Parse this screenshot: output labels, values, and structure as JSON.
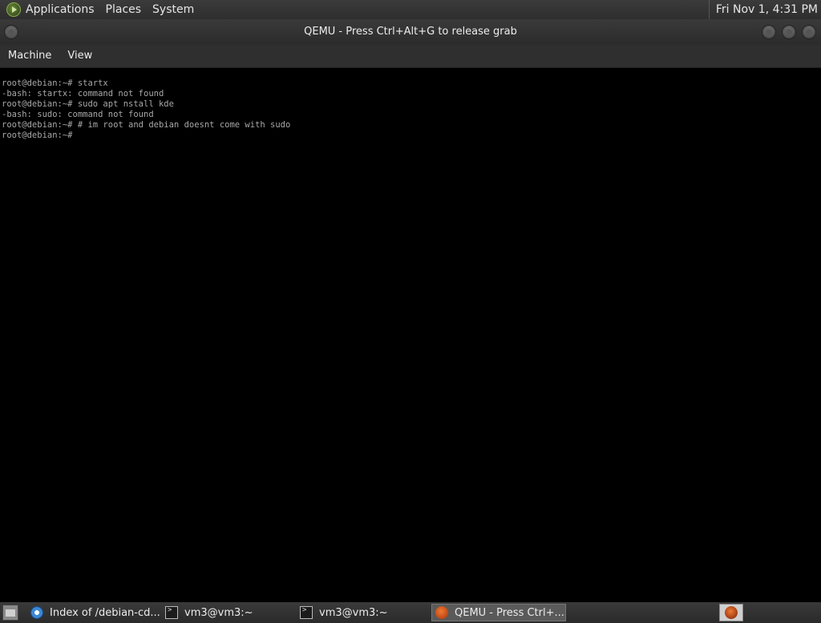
{
  "top_panel": {
    "menus": [
      "Applications",
      "Places",
      "System"
    ],
    "clock": "Fri Nov 1, 4:31 PM"
  },
  "window": {
    "title": "QEMU - Press Ctrl+Alt+G to release grab"
  },
  "menubar": {
    "items": [
      "Machine",
      "View"
    ]
  },
  "terminal": {
    "lines": [
      "root@debian:~# startx",
      "-bash: startx: command not found",
      "root@debian:~# sudo apt nstall kde",
      "-bash: sudo: command not found",
      "root@debian:~# # im root and debian doesnt come with sudo",
      "root@debian:~#"
    ]
  },
  "taskbar": {
    "tasks": [
      {
        "label": "Index of /debian-cd...",
        "icon": "browser-globe-icon"
      },
      {
        "label": "vm3@vm3:~",
        "icon": "terminal-icon"
      },
      {
        "label": "vm3@vm3:~",
        "icon": "terminal-icon"
      },
      {
        "label": "QEMU - Press Ctrl+...",
        "icon": "qemu-icon",
        "active": true
      }
    ]
  },
  "colors": {
    "terminal_text": "#a8a8a8",
    "terminal_bg": "#000000",
    "panel_bg": "#333333"
  }
}
